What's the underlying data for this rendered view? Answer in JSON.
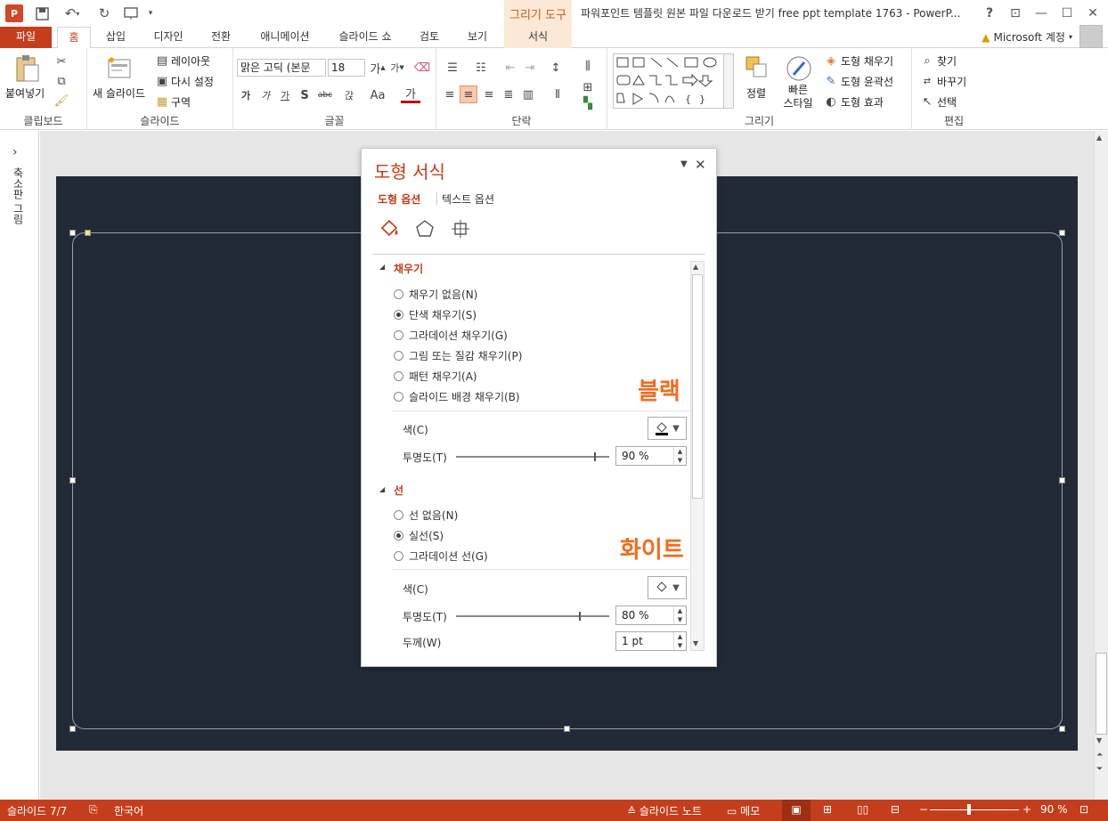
{
  "window": {
    "title": "파워포인트 템플릿 원본 파일 다운로드 받기 free ppt template 1763 - PowerP...",
    "app_logo": "P",
    "context_tab_header": "그리기 도구",
    "help": "?",
    "restore_ribbon": "⊡",
    "minimize": "—",
    "maximize": "☐",
    "close": "✕"
  },
  "tabs": [
    "파일",
    "홈",
    "삽입",
    "디자인",
    "전환",
    "애니메이션",
    "슬라이드 쇼",
    "검토",
    "보기"
  ],
  "context_tab": "서식",
  "account": "Microsoft 계정",
  "ribbon": {
    "clipboard": {
      "label": "클립보드",
      "paste": "붙여넣기"
    },
    "slides": {
      "label": "슬라이드",
      "new_slide": "새 슬라이드",
      "layout": "레이아웃",
      "reset": "다시 설정",
      "section": "구역"
    },
    "font": {
      "label": "글꼴",
      "font_name": "맑은 고딕 (본문",
      "font_size": "18",
      "bold": "가",
      "italic": "가",
      "underline": "가",
      "shadow": "S",
      "strike": "abc",
      "spacing": "갅",
      "case": "Aa",
      "color": "가"
    },
    "paragraph": {
      "label": "단락"
    },
    "drawing": {
      "label": "그리기",
      "arrange": "정렬",
      "quick_styles": "빠른 스타일",
      "shape_fill": "도형 채우기",
      "shape_outline": "도형 윤곽선",
      "shape_effects": "도형 효과"
    },
    "editing": {
      "label": "편집",
      "find": "찾기",
      "replace": "바꾸기",
      "select": "선택"
    }
  },
  "left_pane": {
    "label": "축소판 그림",
    "expand": "›"
  },
  "format_pane": {
    "title": "도형 서식",
    "tab_shape": "도형 옵션",
    "tab_text": "텍스트 옵션",
    "fill": {
      "header": "채우기",
      "options": [
        "채우기 없음(N)",
        "단색 채우기(S)",
        "그라데이션 채우기(G)",
        "그림 또는 질감 채우기(P)",
        "패턴 채우기(A)",
        "슬라이드 배경 채우기(B)"
      ],
      "selected": 1,
      "color_label": "색(C)",
      "transparency_label": "투명도(T)",
      "transparency": "90 %",
      "transparency_fraction": 0.9,
      "annotation": "블랙"
    },
    "line": {
      "header": "선",
      "options": [
        "선 없음(N)",
        "실선(S)",
        "그라데이션 선(G)"
      ],
      "selected": 1,
      "color_label": "색(C)",
      "transparency_label": "투명도(T)",
      "transparency": "80 %",
      "transparency_fraction": 0.8,
      "width_label": "두께(W)",
      "width": "1 pt",
      "annotation": "화이트"
    }
  },
  "status": {
    "slide": "슬라이드 7/7",
    "language": "한국어",
    "notes": "슬라이드 노트",
    "comments": "메모",
    "zoom": "90 %",
    "zoom_minus": "−",
    "zoom_plus": "+"
  },
  "colors": {
    "accent": "#c43e1c",
    "slide_bg": "#222a35",
    "annotation": "#f36b1c"
  }
}
